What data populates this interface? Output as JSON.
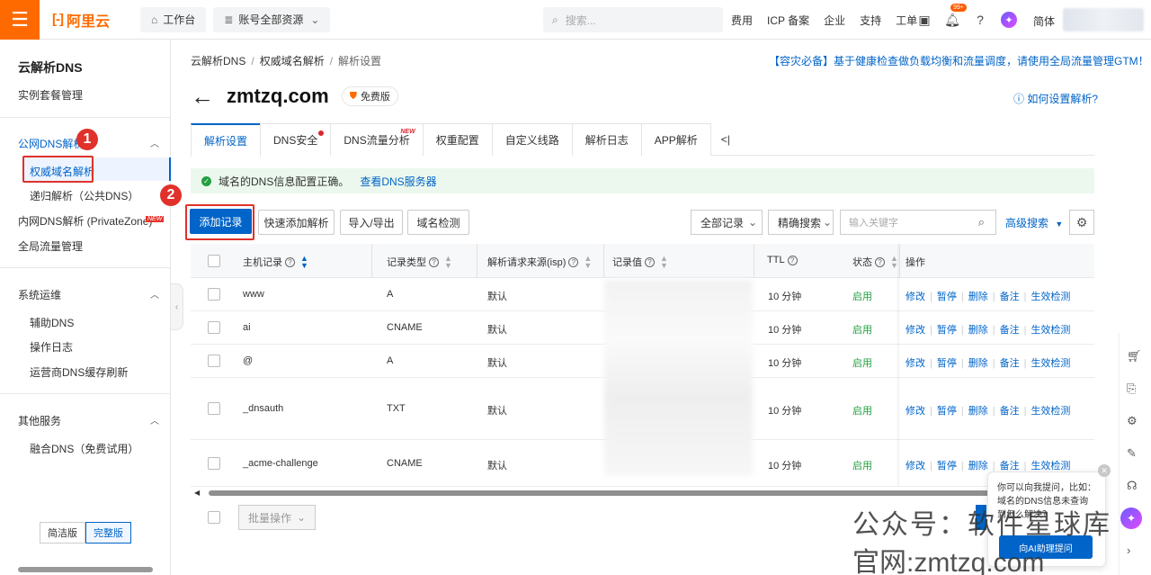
{
  "topbar": {
    "logo_text": "阿里云",
    "workbench": "工作台",
    "resources": "账号全部资源",
    "search_placeholder": "搜索...",
    "links": [
      "费用",
      "ICP 备案",
      "企业",
      "支持",
      "工单"
    ],
    "notif_badge": "99+",
    "lang": "简体"
  },
  "sidebar": {
    "title": "云解析DNS",
    "items": {
      "plan_mgmt": "实例套餐管理",
      "public_dns": "公网DNS解析",
      "auth_dns": "权威域名解析",
      "recursive": "递归解析（公共DNS）",
      "private_zone": "内网DNS解析 (PrivateZone)",
      "private_zone_tag": "NEW",
      "gtm": "全局流量管理",
      "ops_group": "系统运维",
      "aux_dns": "辅助DNS",
      "op_log": "操作日志",
      "isp_cache": "运营商DNS缓存刷新",
      "other_group": "其他服务",
      "fusion_dns": "融合DNS（免费试用）"
    },
    "version_simple": "简洁版",
    "version_full": "完整版"
  },
  "annotations": {
    "step1": "1",
    "step2": "2"
  },
  "breadcrumb": [
    "云解析DNS",
    "权威域名解析",
    "解析设置"
  ],
  "notice": "【容灾必备】基于健康检查做负载均衡和流量调度，请使用全局流量管理GTM！",
  "page": {
    "domain": "zmtzq.com",
    "edition": "免费版",
    "help": "如何设置解析?"
  },
  "tabs": [
    {
      "label": "解析设置",
      "active": true
    },
    {
      "label": "DNS安全",
      "dot": true
    },
    {
      "label": "DNS流量分析",
      "tag": "NEW"
    },
    {
      "label": "权重配置"
    },
    {
      "label": "自定义线路"
    },
    {
      "label": "解析日志"
    },
    {
      "label": "APP解析"
    }
  ],
  "tab_more": "<|",
  "status": {
    "message": "域名的DNS信息配置正确。",
    "link": "查看DNS服务器"
  },
  "toolbar": {
    "add_record": "添加记录",
    "quick_add": "快速添加解析",
    "import_export": "导入/导出",
    "domain_check": "域名检测",
    "record_filter": "全部记录",
    "search_mode": "精确搜索",
    "keyword_placeholder": "输入关键字",
    "advanced_search": "高级搜索"
  },
  "table": {
    "headers": {
      "host": "主机记录",
      "type": "记录类型",
      "line": "解析请求来源(isp)",
      "value": "记录值",
      "ttl": "TTL",
      "status": "状态",
      "actions": "操作"
    },
    "rows": [
      {
        "host": "www",
        "type": "A",
        "line": "默认",
        "ttl": "10 分钟",
        "status": "启用"
      },
      {
        "host": "ai",
        "type": "CNAME",
        "line": "默认",
        "ttl": "10 分钟",
        "status": "启用"
      },
      {
        "host": "@",
        "type": "A",
        "line": "默认",
        "ttl": "10 分钟",
        "status": "启用"
      },
      {
        "host": "_dnsauth",
        "type": "TXT",
        "line": "默认",
        "ttl": "10 分钟",
        "status": "启用"
      },
      {
        "host": "_acme-challenge",
        "type": "CNAME",
        "line": "默认",
        "ttl": "10 分钟",
        "status": "启用"
      }
    ],
    "actions": [
      "修改",
      "暂停",
      "删除",
      "备注",
      "生效检测"
    ]
  },
  "batch_label": "批量操作",
  "ai_popup": {
    "text": "你可以向我提问，比如：域名的DNS信息未查询到怎么解决？",
    "button": "向AI助理提问"
  },
  "watermark": {
    "line1": "公众号：软件星球库",
    "line2": "官网:zmtzq.com"
  }
}
